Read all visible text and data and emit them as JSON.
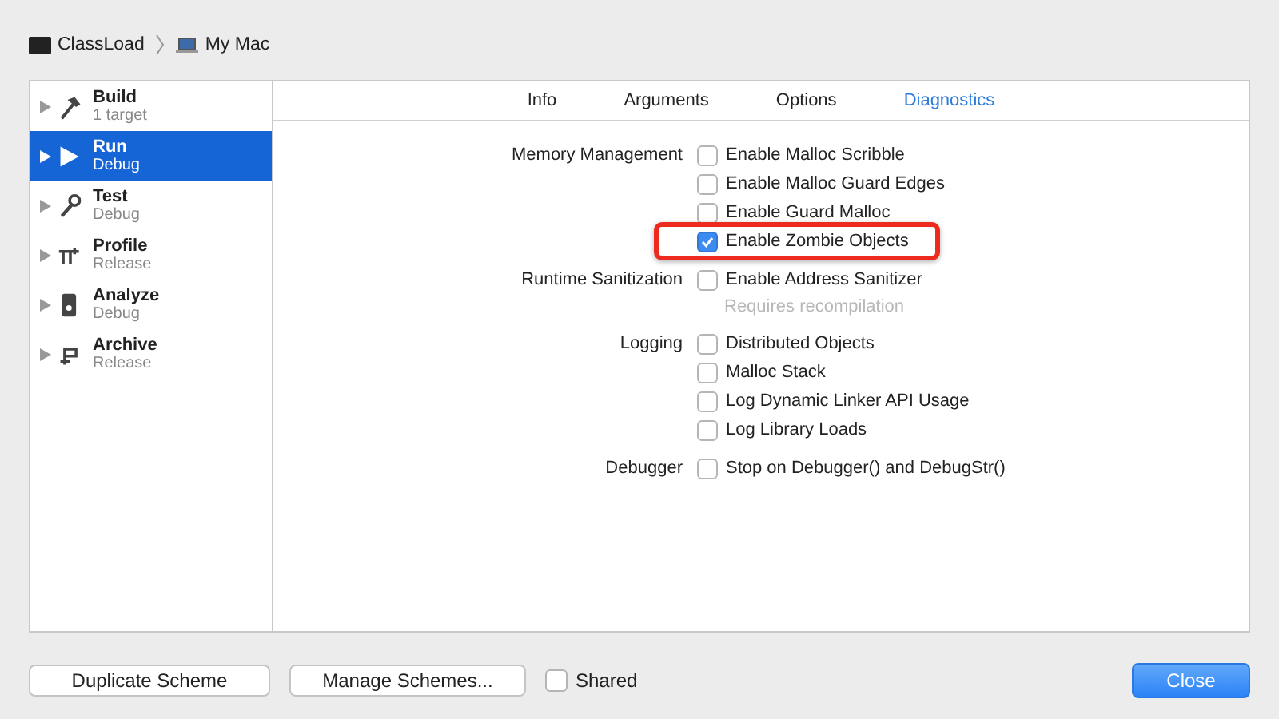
{
  "breadcrumb": [
    {
      "kind": "app",
      "label": "ClassLoad"
    },
    {
      "kind": "computer",
      "label": "My Mac"
    }
  ],
  "sidebar": {
    "items": [
      {
        "label": "Build",
        "sub": "1 target",
        "kind": "build",
        "selected": false
      },
      {
        "label": "Run",
        "sub": "Debug",
        "kind": "run",
        "selected": true
      },
      {
        "label": "Test",
        "sub": "Debug",
        "kind": "test",
        "selected": false
      },
      {
        "label": "Profile",
        "sub": "Release",
        "kind": "profile",
        "selected": false
      },
      {
        "label": "Analyze",
        "sub": "Debug",
        "kind": "analyze",
        "selected": false
      },
      {
        "label": "Archive",
        "sub": "Release",
        "kind": "archive",
        "selected": false
      }
    ]
  },
  "tabs": [
    {
      "label": "Info",
      "selected": false
    },
    {
      "label": "Arguments",
      "selected": false
    },
    {
      "label": "Options",
      "selected": false
    },
    {
      "label": "Diagnostics",
      "selected": true
    }
  ],
  "sections": [
    {
      "label": "Memory Management",
      "options": [
        {
          "label": "Enable Malloc Scribble",
          "checked": false
        },
        {
          "label": "Enable Malloc Guard Edges",
          "checked": false
        },
        {
          "label": "Enable Guard Malloc",
          "checked": false
        },
        {
          "label": "Enable Zombie Objects",
          "checked": true,
          "highlighted": true
        }
      ]
    },
    {
      "label": "Runtime Sanitization",
      "options": [
        {
          "label": "Enable Address Sanitizer",
          "checked": false,
          "note": "Requires recompilation"
        }
      ]
    },
    {
      "label": "Logging",
      "options": [
        {
          "label": "Distributed Objects",
          "checked": false
        },
        {
          "label": "Malloc Stack",
          "checked": false
        },
        {
          "label": "Log Dynamic Linker API Usage",
          "checked": false
        },
        {
          "label": "Log Library Loads",
          "checked": false
        }
      ]
    },
    {
      "label": "Debugger",
      "options": [
        {
          "label": "Stop on Debugger() and DebugStr()",
          "checked": false
        }
      ]
    }
  ],
  "footer": {
    "buttons": [
      {
        "label": "Duplicate Scheme"
      },
      {
        "label": "Manage Schemes..."
      }
    ],
    "shared": {
      "label": "Shared",
      "checked": false
    },
    "close": {
      "label": "Close"
    }
  }
}
